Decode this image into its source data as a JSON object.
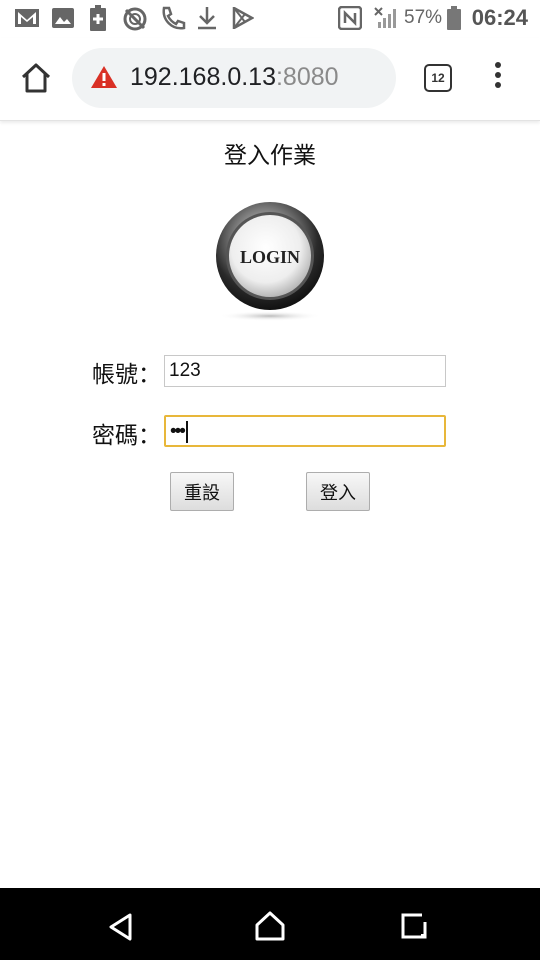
{
  "status_bar": {
    "battery_percent": "57%",
    "time": "06:24",
    "icons": [
      "gmail-icon",
      "image-icon",
      "battery-saver-icon",
      "no-sync-icon",
      "phone-icon",
      "download-icon",
      "play-store-icon",
      "nfc-icon",
      "signal-icon",
      "battery-icon"
    ]
  },
  "browser": {
    "url_host": "192.168.0.13",
    "url_port": ":8080",
    "tab_count": "12"
  },
  "page": {
    "title": "登入作業",
    "logo_text": "LOGIN",
    "account_label": "帳號：",
    "account_value": "123",
    "password_label": "密碼：",
    "password_value": "•••",
    "reset_label": "重設",
    "login_label": "登入"
  },
  "colors": {
    "warning_red": "#d93025",
    "focus_border": "#e8b73a",
    "navbar": "#000000"
  }
}
